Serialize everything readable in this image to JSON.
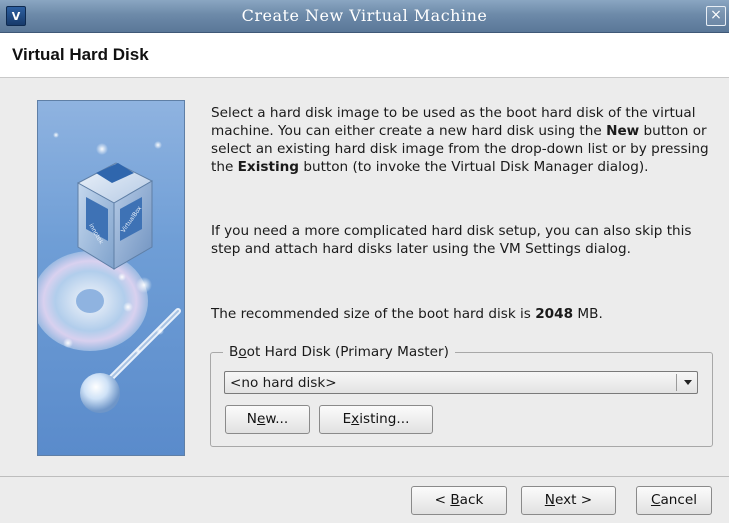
{
  "window": {
    "title": "Create New Virtual Machine",
    "app_icon": "virtualbox-icon",
    "close_label": "×"
  },
  "header": {
    "title": "Virtual Hard Disk"
  },
  "side_image": {
    "icon": "virtualbox-cube-illustration",
    "cube_labels": [
      "innotek",
      "VirtualBox"
    ]
  },
  "description": {
    "p1_part1": "Select a hard disk image to be used as the boot hard disk of the virtual machine. You can either create a new hard disk using the ",
    "p1_new": "New",
    "p1_part2": " button or select an existing hard disk image from the drop-down list or by pressing the ",
    "p1_existing": "Existing",
    "p1_part3": " button (to invoke the Virtual Disk Manager dialog).",
    "p2": "If you need a more complicated hard disk setup, you can also skip this step and attach hard disks later using the VM Settings dialog.",
    "p3_part1": "The recommended size of the boot hard disk is ",
    "p3_size": "2048",
    "p3_part2": " MB."
  },
  "boot_disk": {
    "group_label_pre": "B",
    "group_label_mnemonic": "o",
    "group_label_post": "ot Hard Disk (Primary Master)",
    "selected": "<no hard disk>",
    "new_pre": "N",
    "new_mnemonic": "e",
    "new_post": "w...",
    "existing_pre": "E",
    "existing_mnemonic": "x",
    "existing_post": "isting..."
  },
  "footer": {
    "back_pre": "< ",
    "back_mnemonic": "B",
    "back_post": "ack",
    "next_mnemonic": "N",
    "next_post": "ext >",
    "cancel_mnemonic": "C",
    "cancel_post": "ancel"
  },
  "colors": {
    "titlebar": "#6d8aa9",
    "window_bg": "#ececec",
    "header_bg": "#ffffff",
    "side_image_bg": "#6f9ed6"
  }
}
